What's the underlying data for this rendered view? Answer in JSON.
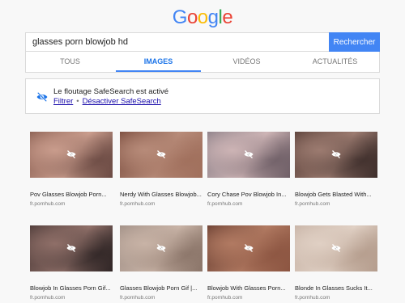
{
  "logo": {
    "letters": [
      "G",
      "o",
      "o",
      "g",
      "l",
      "e"
    ],
    "colors": [
      "#4285f4",
      "#ea4335",
      "#fbbc05",
      "#4285f4",
      "#34a853",
      "#ea4335"
    ]
  },
  "search": {
    "value": "glasses porn blowjob hd",
    "button_label": "Rechercher"
  },
  "tabs": [
    {
      "label": "TOUS"
    },
    {
      "label": "IMAGES"
    },
    {
      "label": "VIDÉOS"
    },
    {
      "label": "ACTUALITÉS"
    }
  ],
  "safesearch": {
    "title": "Le floutage SafeSearch est activé",
    "filter_label": "Filtrer",
    "separator": "•",
    "disable_label": "Désactiver SafeSearch"
  },
  "results": [
    {
      "title": "Pov Glasses Blowjob Porn...",
      "source": "fr.pornhub.com",
      "colors": [
        "#8a5f52",
        "#c99c8c",
        "#6b4a43"
      ]
    },
    {
      "title": "Nerdy With Glasses Blowjob...",
      "source": "fr.pornhub.com",
      "colors": [
        "#7a4c3e",
        "#b78b79",
        "#a06f5c"
      ]
    },
    {
      "title": "Cory Chase Pov Blowjob In...",
      "source": "fr.pornhub.com",
      "colors": [
        "#8c8088",
        "#cdb4b5",
        "#6e5e66"
      ]
    },
    {
      "title": "Blowjob Gets Blasted With...",
      "source": "fr.pornhub.com",
      "colors": [
        "#5a4039",
        "#9c7b70",
        "#3e2e2b"
      ]
    },
    {
      "title": "Blowjob In Glasses Porn Gif...",
      "source": "fr.pornhub.com",
      "colors": [
        "#4c3a38",
        "#8f6f68",
        "#2f2525"
      ]
    },
    {
      "title": "Glasses Blowjob Porn Gif |...",
      "source": "fr.pornhub.com",
      "colors": [
        "#a08f86",
        "#c8b3a6",
        "#8a7468"
      ]
    },
    {
      "title": "Blowjob With Glasses Porn...",
      "source": "fr.pornhub.com",
      "colors": [
        "#6a3f32",
        "#b17a62",
        "#8c5541"
      ]
    },
    {
      "title": "Blonde In Glasses Sucks It...",
      "source": "fr.pornhub.com",
      "colors": [
        "#c7b3a6",
        "#e0d0c4",
        "#b49c8c"
      ]
    }
  ]
}
